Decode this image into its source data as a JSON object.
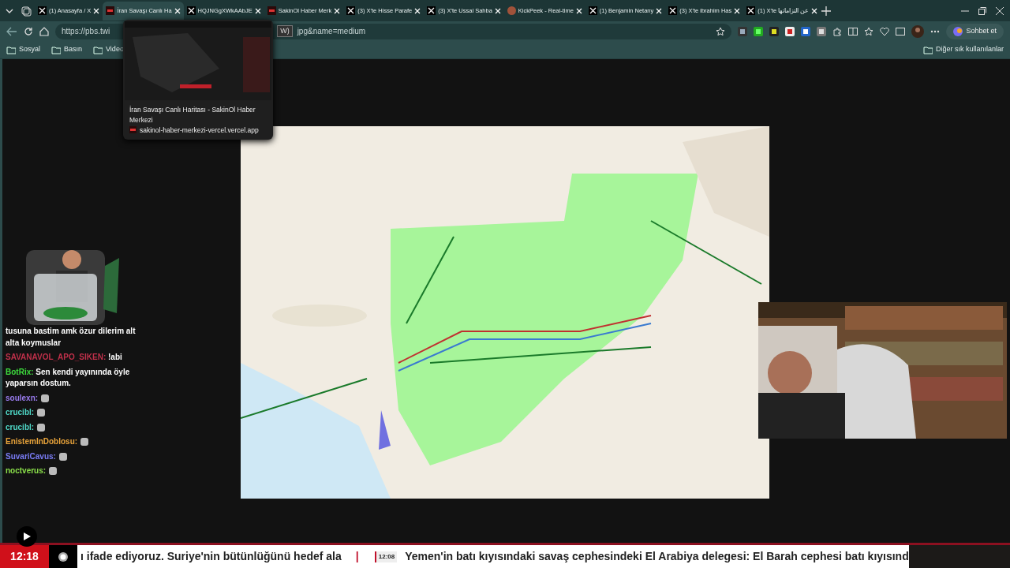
{
  "tabs": [
    {
      "kind": "x",
      "title": "(1) Anasayfa / X",
      "selected": false
    },
    {
      "kind": "news",
      "title": "İran Savaşı Canlı Ha",
      "selected": true
    },
    {
      "kind": "x",
      "title": "HQJNGgXWkAAbJE",
      "selected": false
    },
    {
      "kind": "news",
      "title": "SakinOl Haber Merk",
      "selected": false
    },
    {
      "kind": "x",
      "title": "(3) X'te Hisse Parafe",
      "selected": false
    },
    {
      "kind": "x",
      "title": "(3) X'te Ussal Sahba",
      "selected": false
    },
    {
      "kind": "kick",
      "title": "KickPeek - Real-time",
      "selected": false
    },
    {
      "kind": "x",
      "title": "(1) Benjamin Netany",
      "selected": false
    },
    {
      "kind": "x",
      "title": "(3) X'te ibrahim Has",
      "selected": false
    },
    {
      "kind": "x",
      "title": "(1) X'te عن التزاماتها",
      "selected": false
    }
  ],
  "address_bar": {
    "start": "https://pbs.twi",
    "end": "jpg&name=medium"
  },
  "hidden_tooltip": "W)",
  "copilot_button": "Sohbet et",
  "bookmarks": [
    "Sosyal",
    "Basın",
    "Video"
  ],
  "other_bookmarks": "Diğer sık kullanılanlar",
  "tab_preview": {
    "title": "İran Savaşı Canlı Haritası - SakinOl Haber Merkezi",
    "url": "sakinol-haber-merkezi-vercel.vercel.app"
  },
  "chat": [
    {
      "text": "tusuna bastim amk özur dilerim alt alta koymuslar"
    },
    {
      "user": "SAVANAVOL_APO_SIKEN:",
      "color": "#c0304a",
      "text": "!abi"
    },
    {
      "user": "BotRix:",
      "color": "#3ddc3d",
      "text": "Sen kendi yayınında öyle yaparsın dostum."
    },
    {
      "user": "soulexn:",
      "color": "#9a7cf0"
    },
    {
      "user": "crucibl:",
      "color": "#4fd9c8"
    },
    {
      "user": "crucibl:",
      "color": "#4fd9c8"
    },
    {
      "user": "EnistemInDoblosu:",
      "color": "#e8a33a"
    },
    {
      "user": "SuvariCavus:",
      "color": "#7a7cf5"
    },
    {
      "user": "noctverus:",
      "color": "#8be04a"
    }
  ],
  "ticker": {
    "time": "12:18",
    "text_1": "ı ifade ediyoruz. Suriye'nin bütünlüğünü hedef ala",
    "separator": "|",
    "item_time": "12:08",
    "text_2": "Yemen'in batı kıyısındaki savaş cephesindeki El Arabiya delegesi: El Barah cephesi batı kıyısınd"
  }
}
